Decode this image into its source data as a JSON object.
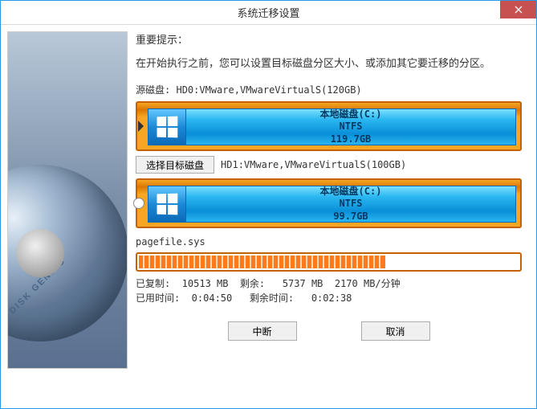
{
  "window": {
    "title": "系统迁移设置"
  },
  "hint": {
    "title": "重要提示：",
    "text": "在开始执行之前，您可以设置目标磁盘分区大小、或添加其它要迁移的分区。"
  },
  "source": {
    "label": "源磁盘:",
    "value": "HD0:VMware,VMwareVirtualS(120GB)"
  },
  "target": {
    "button": "选择目标磁盘",
    "value": "HD1:VMware,VMwareVirtualS(100GB)"
  },
  "partition_source": {
    "name": "本地磁盘(C:)",
    "fs": "NTFS",
    "size": "119.7GB"
  },
  "partition_target": {
    "name": "本地磁盘(C:)",
    "fs": "NTFS",
    "size": "99.7GB"
  },
  "file": {
    "current": "pagefile.sys"
  },
  "progress": {
    "percent": 65
  },
  "stats": {
    "line1": "已复制:  10513 MB  剩余:   5737 MB  2170 MB/分钟",
    "line2": "已用时间:  0:04:50   剩余时间:   0:02:38"
  },
  "buttons": {
    "interrupt": "中断",
    "cancel": "取消"
  },
  "brand": "DISK GENIUS"
}
